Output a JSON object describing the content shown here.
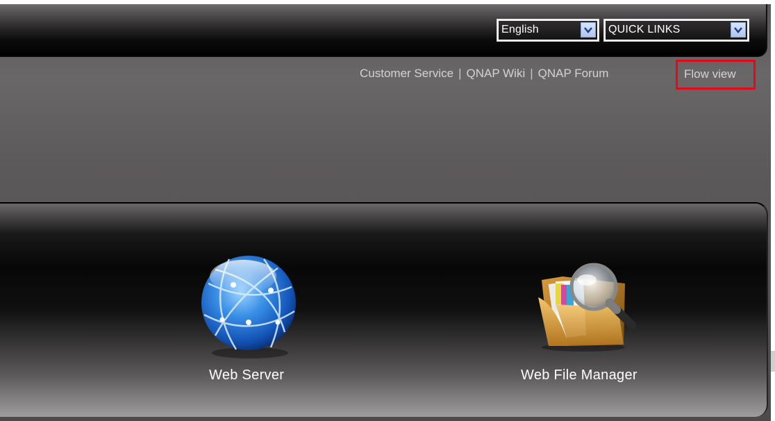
{
  "header": {
    "language_select": {
      "value": "English"
    },
    "quick_links_select": {
      "value": "QUICK LINKS"
    }
  },
  "links": {
    "customer_service": "Customer Service",
    "separator": "|",
    "qnap_wiki": "QNAP Wiki",
    "qnap_forum": "QNAP Forum",
    "flow_view": "Flow view"
  },
  "apps": [
    {
      "label": "Web Server",
      "icon": "globe-icon"
    },
    {
      "label": "Web File Manager",
      "icon": "folder-magnifier-icon"
    }
  ],
  "colors": {
    "highlight_border": "#e3091b",
    "link_text": "#d4d2d3",
    "select_arrow": "#aec3ef"
  }
}
